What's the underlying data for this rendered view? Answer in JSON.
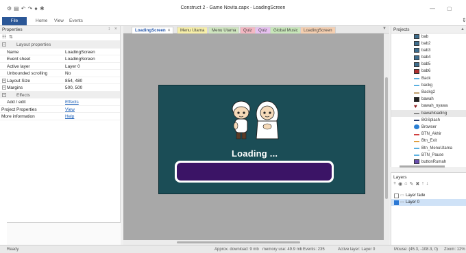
{
  "window": {
    "title": "Construct 2 - Game Novita.capx - LoadingScreen"
  },
  "ribbon": {
    "file_label": "File",
    "tabs": [
      "Home",
      "View",
      "Events"
    ]
  },
  "properties": {
    "title": "Properties",
    "pin": "↕",
    "close": "×",
    "rows": [
      {
        "label": "Layout properties",
        "type": "category"
      },
      {
        "label": "Name",
        "value": "LoadingScreen"
      },
      {
        "label": "Event sheet",
        "value": "LoadingScreen"
      },
      {
        "label": "Active layer",
        "value": "Layer 0"
      },
      {
        "label": "Unbounded scrolling",
        "value": "No"
      },
      {
        "label": "Layout Size",
        "value": "854, 480",
        "expandable": true
      },
      {
        "label": "Margins",
        "value": "500, 500",
        "expandable": true
      },
      {
        "label": "Effects",
        "type": "category"
      },
      {
        "label": "Add / edit",
        "value": "Effects",
        "link": true
      },
      {
        "label": "Project Properties",
        "value": "View",
        "link": true,
        "root": true
      },
      {
        "label": "More information",
        "value": "Help",
        "link": true,
        "root": true
      }
    ]
  },
  "editor": {
    "tabs": [
      {
        "label": "LoadingScreen",
        "color": "#ffffff",
        "active": true,
        "close": "×"
      },
      {
        "label": "Menu Utama",
        "color": "#f7efa8"
      },
      {
        "label": "Menu Utama",
        "color": "#cfe6bf"
      },
      {
        "label": "Quiz",
        "color": "#f4b7c2"
      },
      {
        "label": "Quiz",
        "color": "#e7c0f0"
      },
      {
        "label": "Global Music",
        "color": "#c8e7b9"
      },
      {
        "label": "LoadingScreen",
        "color": "#f5cfb0"
      }
    ],
    "dropdown": "▼",
    "loading_text": "Loading ...",
    "layout_bg": "#1b4d56",
    "bar_fill": "#3b1466"
  },
  "projects": {
    "title": "Projects",
    "items": [
      {
        "name": "bab",
        "icon": "image-icon",
        "color": "#3e6e8e"
      },
      {
        "name": "bab2",
        "icon": "image-icon",
        "color": "#3e6e8e"
      },
      {
        "name": "bab3",
        "icon": "image-icon",
        "color": "#3e6e8e"
      },
      {
        "name": "bab4",
        "icon": "image-icon",
        "color": "#3e6e8e"
      },
      {
        "name": "bab5",
        "icon": "image-icon",
        "color": "#3e6e8e"
      },
      {
        "name": "bab6",
        "icon": "image-icon",
        "color": "#b03030"
      },
      {
        "name": "Back",
        "icon": "sprite-line-icon",
        "color": "#5bb0e0"
      },
      {
        "name": "backg",
        "icon": "sprite-line-icon",
        "color": "#5bb0e0"
      },
      {
        "name": "Backg2",
        "icon": "sprite-line-icon",
        "color": "#c0a070"
      },
      {
        "name": "bawah",
        "icon": "sprite-block-icon",
        "color": "#222222"
      },
      {
        "name": "bawah_nyawa",
        "icon": "heart-icon",
        "color": "#8b1a1a"
      },
      {
        "name": "bawahloading",
        "icon": "sprite-line-icon",
        "color": "#888888",
        "selected": true
      },
      {
        "name": "BGSplash",
        "icon": "sprite-line-icon",
        "color": "#2c3f6e"
      },
      {
        "name": "Browser",
        "icon": "browser-icon",
        "color": "#2a7fd4"
      },
      {
        "name": "BTN_Akhir",
        "icon": "sprite-line-icon",
        "color": "#d04040"
      },
      {
        "name": "Btn_Exit",
        "icon": "sprite-line-icon",
        "color": "#e0a040"
      },
      {
        "name": "Btn_MenuUtama",
        "icon": "sprite-line-icon",
        "color": "#5bb0e0"
      },
      {
        "name": "BTN_Pause",
        "icon": "sprite-line-icon",
        "color": "#5bb0e0"
      },
      {
        "name": "buttonRumah",
        "icon": "sprite-house-icon",
        "color": "#6a4fb0"
      }
    ]
  },
  "layers": {
    "title": "Layers",
    "tools": [
      "+",
      "◉",
      "⌂",
      "✎",
      "✖",
      "↑",
      "↓"
    ],
    "items": [
      {
        "name": "Layer fade",
        "checked": false
      },
      {
        "name": "Layer 0",
        "checked": true,
        "selected": true
      }
    ]
  },
  "status": {
    "ready": "Ready",
    "download": "Approx. download: 9 mb",
    "memory": "memory use: 49.9 mb",
    "events": "Events: 235",
    "active_layer": "Active layer: Layer 0",
    "mouse": "Mouse: (45.3, -108.3, 0)",
    "zoom": "Zoom: 12%"
  }
}
